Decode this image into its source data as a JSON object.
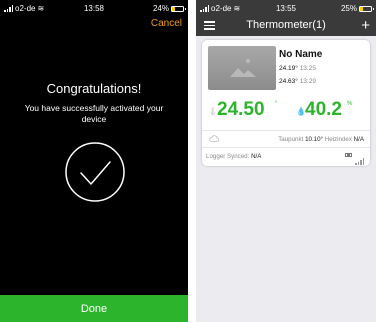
{
  "left": {
    "status": {
      "carrier": "o2-de",
      "time": "13:58",
      "battery": "24%",
      "battery_level": 0.24
    },
    "cancel_label": "Cancel",
    "heading": "Congratulations!",
    "message": "You have successfully activated your device",
    "done_label": "Done",
    "colors": {
      "accent": "#f09a20",
      "success": "#2cb52c"
    }
  },
  "right": {
    "status": {
      "carrier": "o2-de",
      "time": "13:55",
      "battery": "25%",
      "battery_level": 0.25
    },
    "title": "Thermometer(1)",
    "device": {
      "name": "No Name",
      "min_value": "24.19°",
      "min_time": "13:25",
      "max_value": "24.63°",
      "max_time": "13:29",
      "temperature": "24.50",
      "temperature_unit": "°",
      "humidity": "40.2",
      "humidity_unit": "%",
      "dewpoint_label": "Taupunkt",
      "dewpoint_value": "10.10°",
      "heat_index_label": "Heizindex",
      "heat_index_value": "N/A",
      "logger_label": "Logger Synced:",
      "logger_value": "N/A"
    },
    "icons": {
      "menu": "menu-icon",
      "add": "plus-icon",
      "temp": "thermometer-icon",
      "humidity": "droplet-icon",
      "weather": "cloud-icon"
    },
    "colors": {
      "navbar": "#3a3a3a",
      "reading": "#2cb52c"
    }
  }
}
